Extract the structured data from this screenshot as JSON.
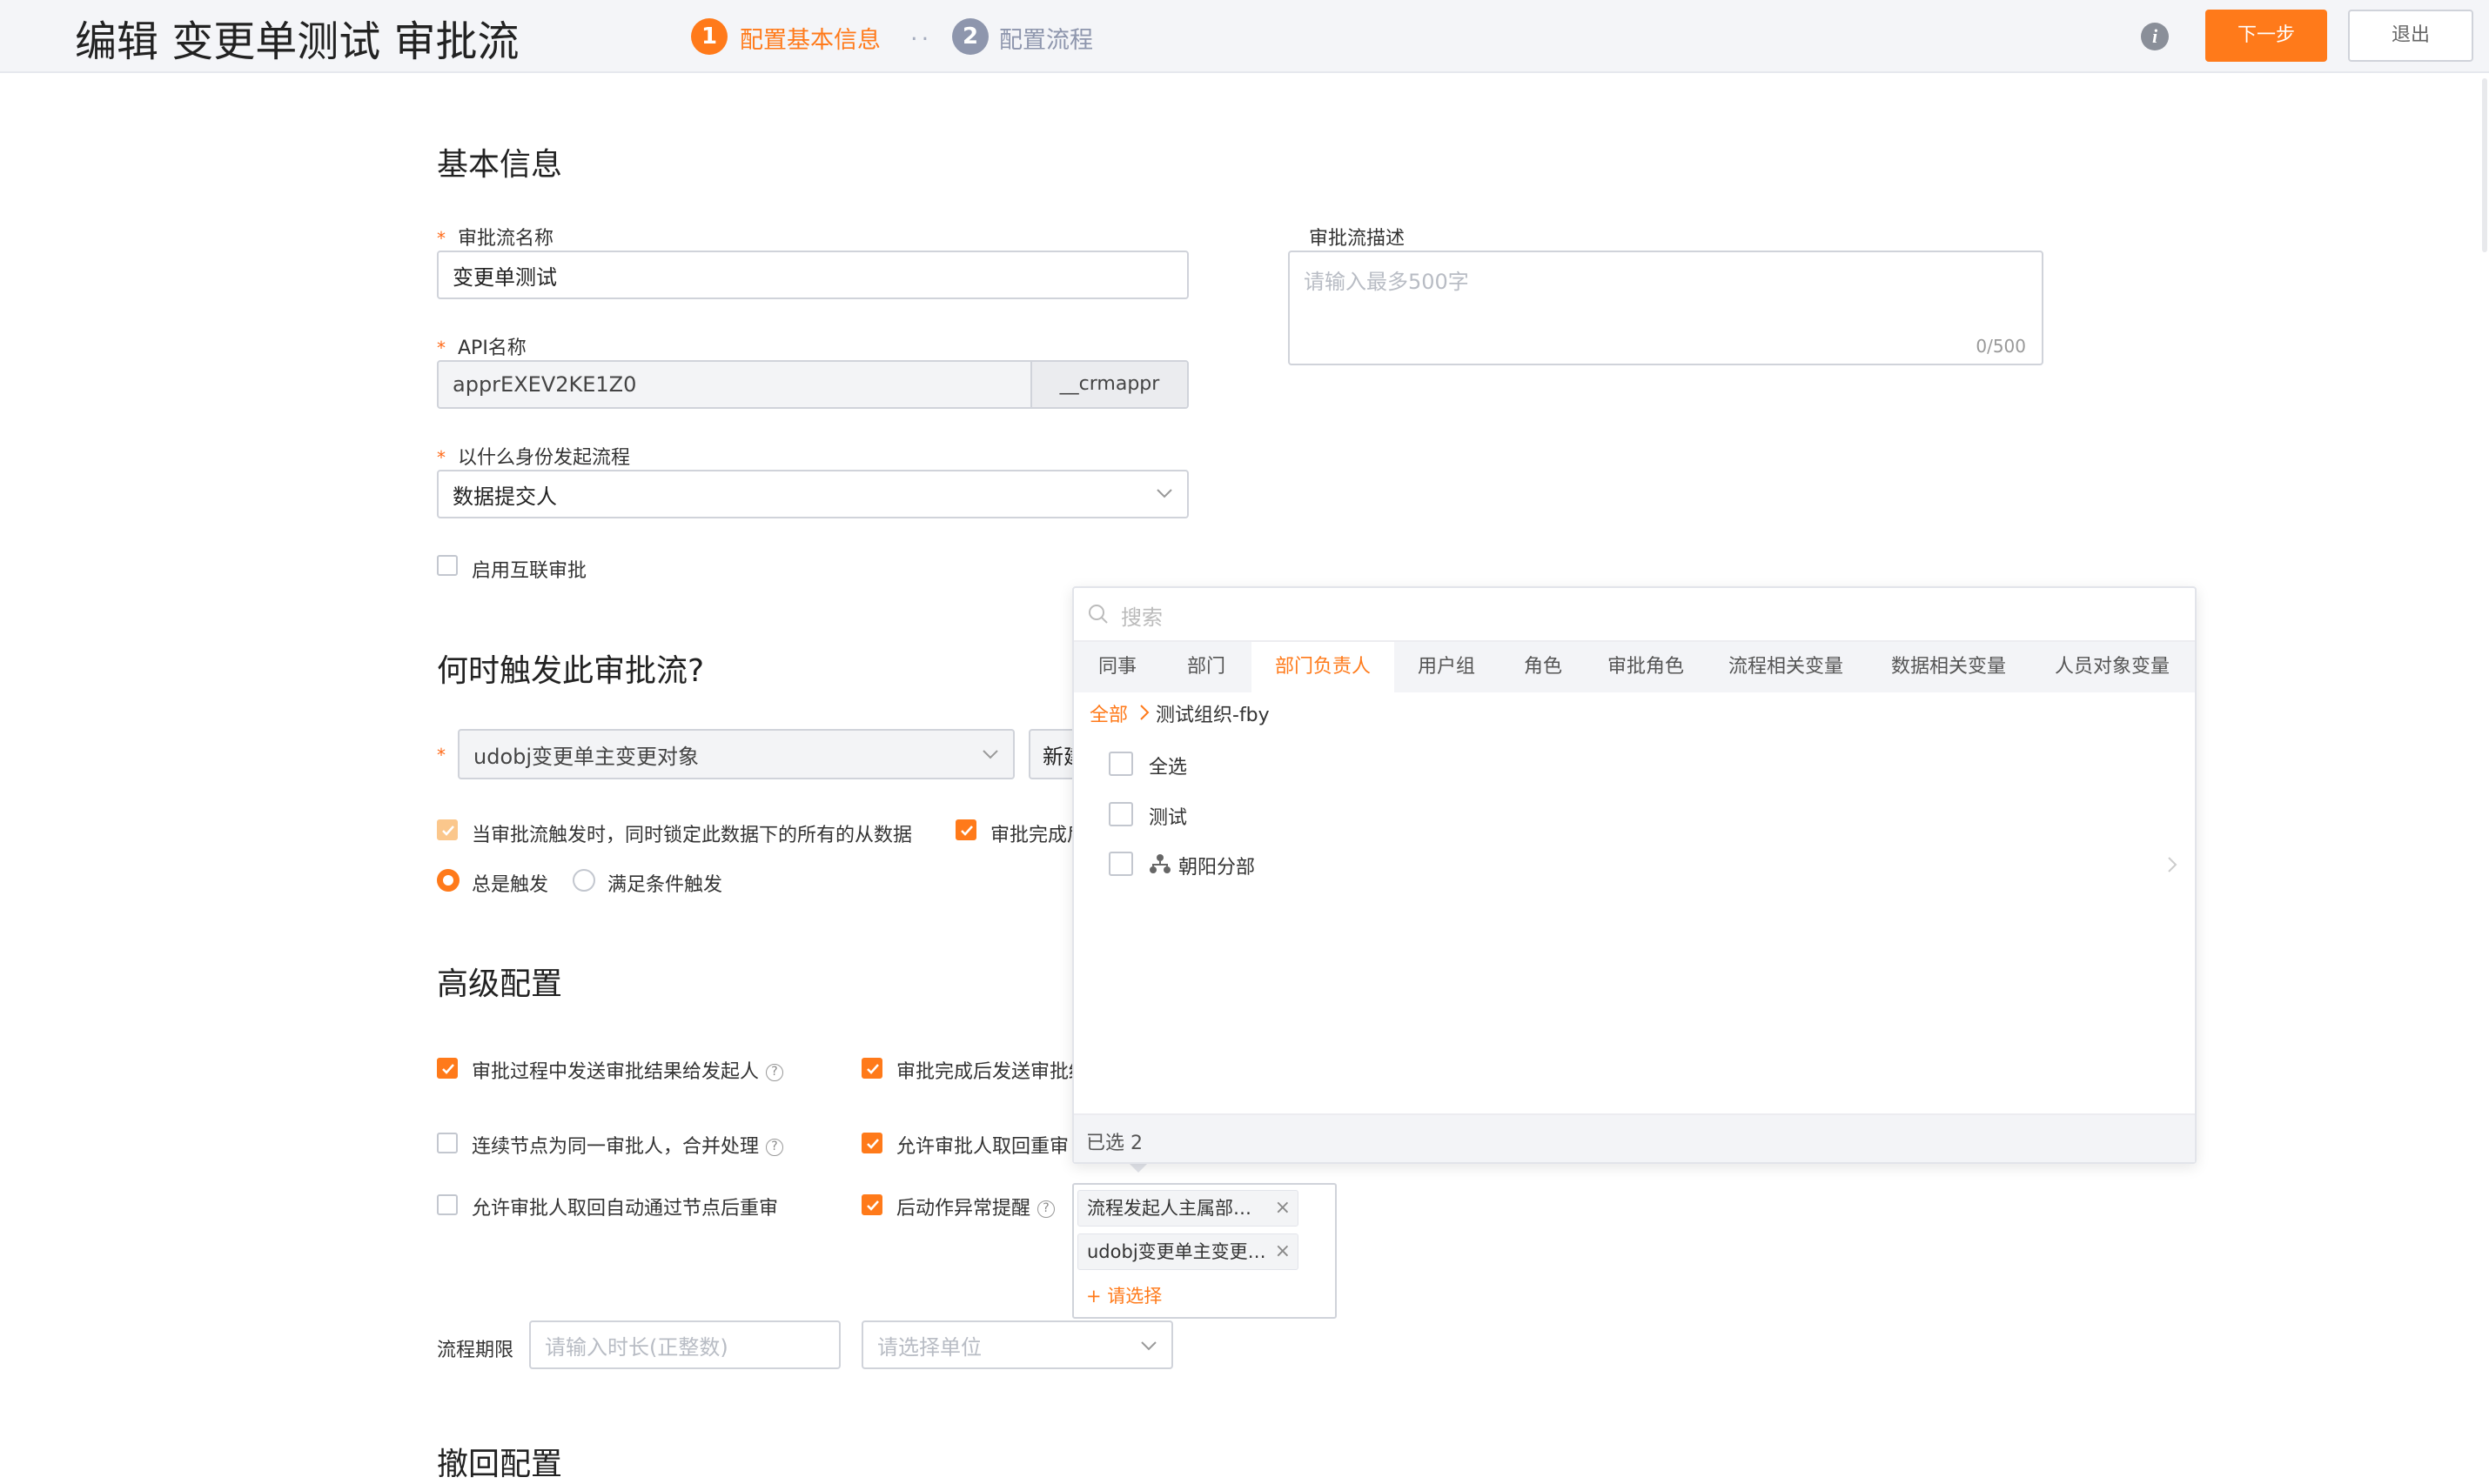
{
  "header": {
    "title": "编辑 变更单测试 审批流",
    "steps": [
      {
        "num": "1",
        "label": "配置基本信息",
        "color": "#ff7a1a"
      },
      {
        "num": "2",
        "label": "配置流程",
        "color": "#8e96ad"
      }
    ],
    "step_sep": "..",
    "next_label": "下一步",
    "exit_label": "退出"
  },
  "basic": {
    "title": "基本信息",
    "name_label": "审批流名称",
    "name_value": "变更单测试",
    "api_label": "API名称",
    "api_value": "apprEXEV2KE1Z0",
    "api_suffix": "__crmappr",
    "identity_label": "以什么身份发起流程",
    "identity_value": "数据提交人",
    "interconnect_label": "启用互联审批",
    "desc_label": "审批流描述",
    "desc_placeholder": "请输入最多500字",
    "desc_counter": "0/500"
  },
  "trigger": {
    "title": "何时触发此审批流?",
    "object_value": "udobj变更单主变更对象",
    "new_button_partial": "新建",
    "lock_label": "当审批流触发时，同时锁定此数据下的所有的从数据",
    "complete_partial": "审批完成后",
    "radio_always": "总是触发",
    "radio_condition": "满足条件触发"
  },
  "advanced": {
    "title": "高级配置",
    "opt1": "审批过程中发送审批结果给发起人",
    "opt2": "审批完成后发送审批结",
    "opt3": "连续节点为同一审批人，合并处理",
    "opt4": "允许审批人取回重审",
    "opt5": "允许审批人取回自动通过节点后重审",
    "opt6": "后动作异常提醒",
    "deadline_label": "流程期限",
    "duration_placeholder": "请输入时长(正整数)",
    "unit_placeholder": "请选择单位"
  },
  "withdraw": {
    "title": "撤回配置"
  },
  "popup": {
    "search_placeholder": "搜索",
    "tabs": [
      "同事",
      "部门",
      "部门负责人",
      "用户组",
      "角色",
      "审批角色",
      "流程相关变量",
      "数据相关变量",
      "人员对象变量"
    ],
    "active_tab": "部门负责人",
    "breadcrumb_root": "全部",
    "breadcrumb_current": "测试组织-fby",
    "items": [
      "全选",
      "测试",
      "朝阳分部"
    ],
    "selected_count": "已选 2"
  },
  "selection": {
    "tags": [
      "流程发起人主属部…",
      "udobj变更单主变更…"
    ],
    "add_label": "+ 请选择"
  },
  "colors": {
    "accent": "#ff7a1a"
  }
}
